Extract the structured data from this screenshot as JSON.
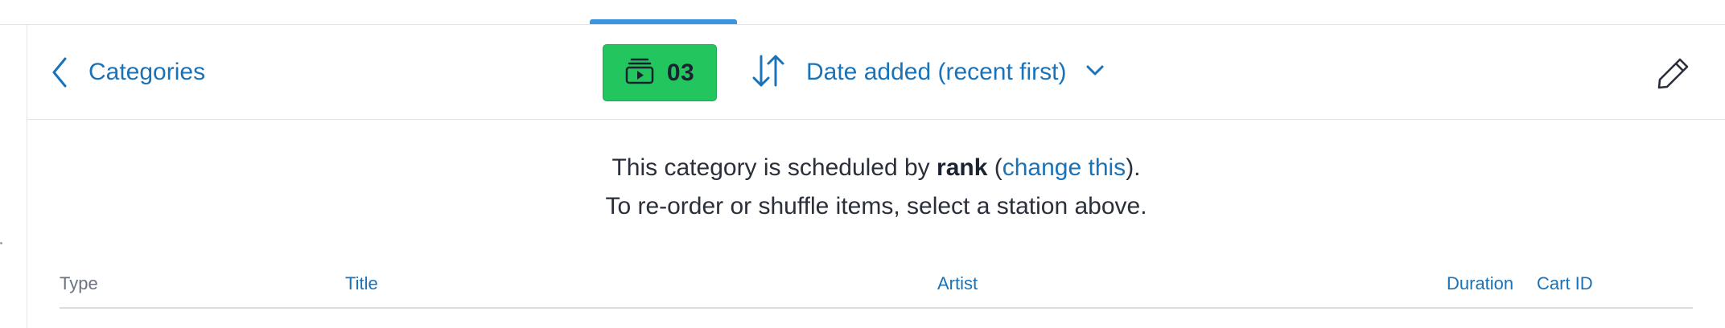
{
  "toolbar": {
    "back_label": "Categories",
    "station_number": "03",
    "sort_label": "Date added (recent first)"
  },
  "notice": {
    "line1_prefix": "This category is scheduled by ",
    "line1_bold": "rank",
    "line1_open_paren": " (",
    "line1_link": "change this",
    "line1_suffix": ").",
    "line2": "To re-order or shuffle items, select a station above."
  },
  "table": {
    "columns": [
      "Type",
      "Title",
      "Artist",
      "Duration",
      "Cart ID"
    ]
  },
  "colors": {
    "accent": "#1a73b8",
    "tab_indicator": "#3a95e0",
    "station_badge": "#22c55e"
  },
  "icons": {
    "back": "chevron-left-icon",
    "station": "playlist-play-icon",
    "sort": "sort-arrows-icon",
    "dropdown": "chevron-down-icon",
    "edit": "pencil-icon"
  }
}
